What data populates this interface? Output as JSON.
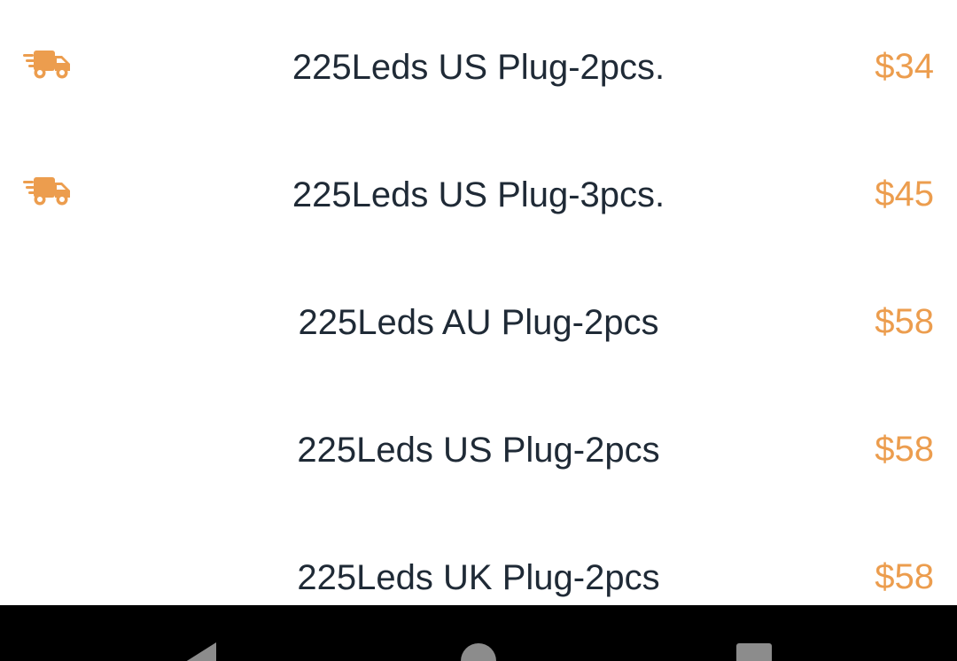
{
  "colors": {
    "accent": "#ec9d4e",
    "text": "#1f2a36",
    "navbar": "#000000",
    "nav_icon": "#8c8c8c"
  },
  "variants": [
    {
      "name": "225Leds US Plug-2pcs.",
      "price": "$34",
      "shipping_icon": "delivery-truck-icon"
    },
    {
      "name": "225Leds US Plug-3pcs.",
      "price": "$45",
      "shipping_icon": "delivery-truck-icon"
    },
    {
      "name": "225Leds AU Plug-2pcs",
      "price": "$58"
    },
    {
      "name": "225Leds US Plug-2pcs",
      "price": "$58"
    },
    {
      "name": "225Leds UK Plug-2pcs",
      "price": "$58"
    }
  ],
  "navigation": {
    "back_icon": "back-icon",
    "home_icon": "home-icon",
    "recents_icon": "recents-icon"
  }
}
